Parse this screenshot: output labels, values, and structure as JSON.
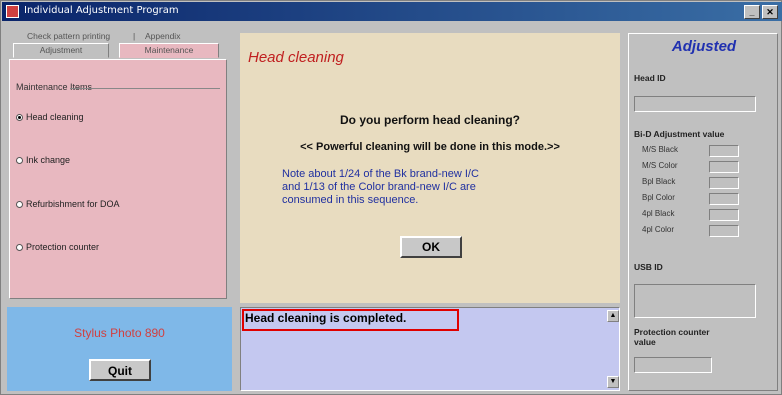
{
  "window": {
    "title": "Individual Adjustment Program",
    "minimize_label": "_",
    "close_label": "✕"
  },
  "tabs": {
    "row1": [
      "Check pattern printing",
      "Appendix"
    ],
    "row2": [
      "Adjustment",
      "Maintenance"
    ]
  },
  "maintenance": {
    "group_title": "Maintenance Items",
    "options": [
      {
        "label": "Head cleaning",
        "selected": true
      },
      {
        "label": "Ink change",
        "selected": false
      },
      {
        "label": "Refurbishment for DOA",
        "selected": false
      },
      {
        "label": "Protection counter",
        "selected": false
      }
    ]
  },
  "model": {
    "name": "Stylus Photo 890",
    "quit_label": "Quit"
  },
  "dialog": {
    "title": "Head cleaning",
    "question": "Do you perform head cleaning?",
    "mode_note": "<< Powerful cleaning will be done in this mode.>>",
    "note_lines": [
      "Note about 1/24 of the Bk brand-new I/C",
      "and 1/13 of the Color brand-new I/C are",
      "consumed in this sequence."
    ],
    "ok_label": "OK"
  },
  "message": {
    "text": "Head cleaning is completed."
  },
  "adjusted": {
    "heading": "Adjusted",
    "head_id_label": "Head ID",
    "bi_d_label": "Bi-D Adjustment value",
    "bi_d_rows": [
      "M/S Black",
      "M/S Color",
      "Bpl Black",
      "Bpl Color",
      "4pl Black",
      "4pl Color"
    ],
    "usb_id_label": "USB ID",
    "protection_label_1": "Protection counter",
    "protection_label_2": "value"
  },
  "colors": {
    "pink_panel": "#e8b8c0",
    "blue_panel": "#7fb8e8",
    "tan_panel": "#e8dcc0",
    "message_bg": "#c4c8f0",
    "highlight_border": "#e00000",
    "title_red": "#c02020",
    "adjusted_blue": "#2030b0"
  }
}
